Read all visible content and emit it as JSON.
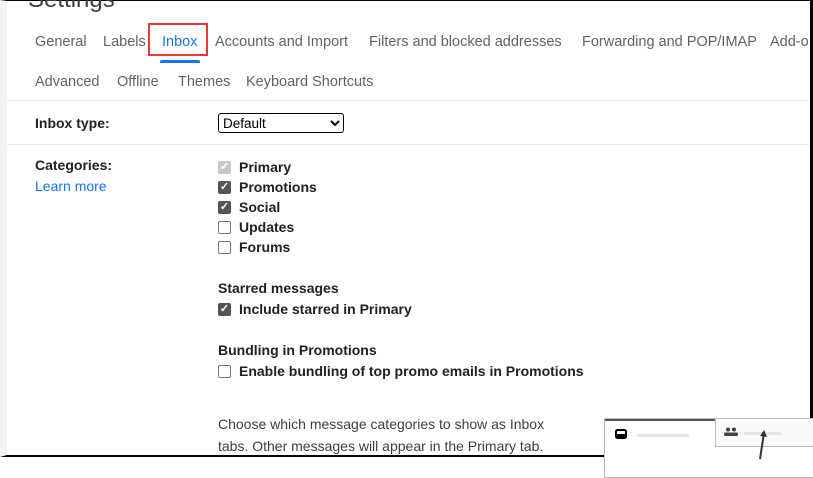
{
  "header": {
    "title": "Settings"
  },
  "tabs": [
    "General",
    "Labels",
    "Inbox",
    "Accounts and Import",
    "Filters and blocked addresses",
    "Forwarding and POP/IMAP",
    "Add-o"
  ],
  "tabs_row2": [
    "Advanced",
    "Offline",
    "Themes",
    "Keyboard Shortcuts"
  ],
  "inbox_type": {
    "label": "Inbox type:",
    "value": "Default"
  },
  "categories": {
    "label": "Categories:",
    "link": "Learn more",
    "items": [
      {
        "label": "Primary",
        "checked": true,
        "disabled": true
      },
      {
        "label": "Promotions",
        "checked": true
      },
      {
        "label": "Social",
        "checked": true
      },
      {
        "label": "Updates",
        "checked": false
      },
      {
        "label": "Forums",
        "checked": false
      }
    ]
  },
  "starred": {
    "heading": "Starred messages",
    "option": "Include starred in Primary"
  },
  "bundling": {
    "heading": "Bundling in Promotions",
    "option": "Enable bundling of top promo emails in Promotions"
  },
  "description": "Choose which message categories to show as Inbox tabs. Other messages will appear in the Primary tab."
}
